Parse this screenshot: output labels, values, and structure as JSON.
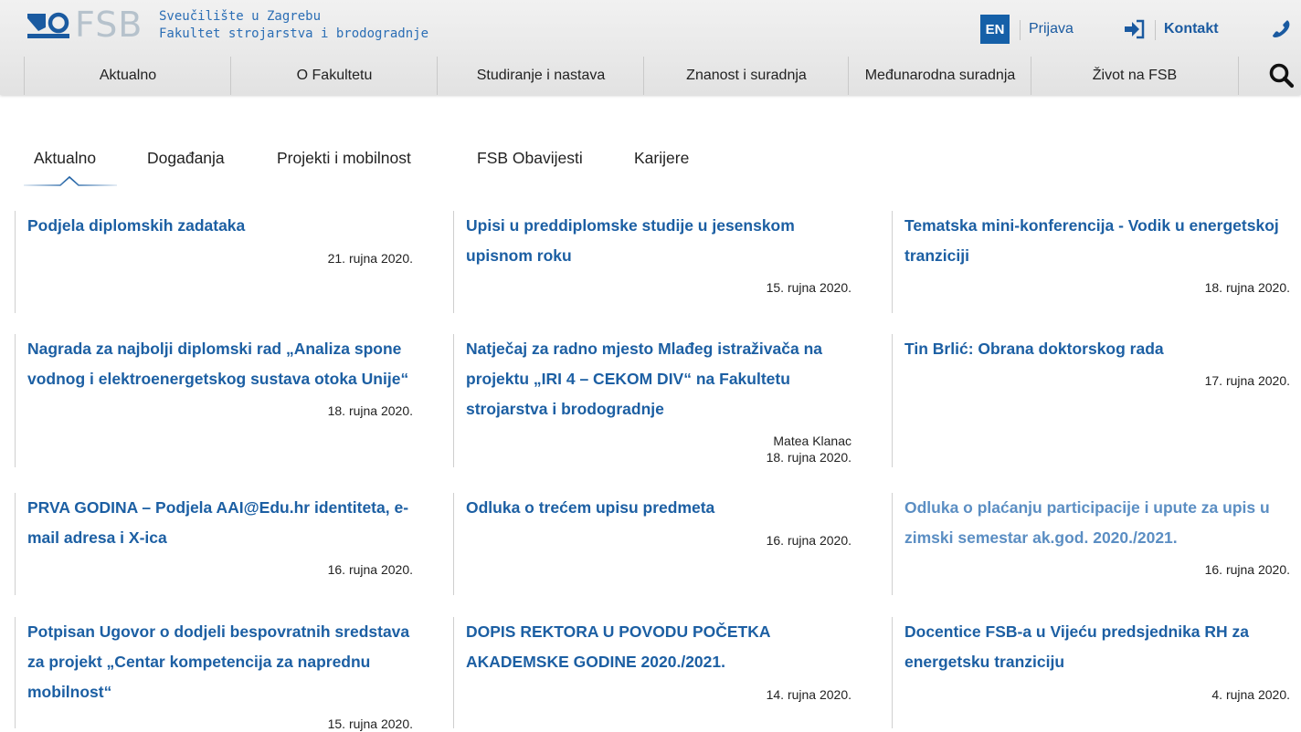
{
  "header": {
    "logo": {
      "wordmark": "FSB",
      "line1": "Sveučilište u Zagrebu",
      "line2": "Fakultet strojarstva i brodogradnje"
    },
    "lang_button": "EN",
    "login_label": "Prijava",
    "contact_label": "Kontakt"
  },
  "nav": {
    "items": [
      "Aktualno",
      "O Fakultetu",
      "Studiranje i nastava",
      "Znanost i suradnja",
      "Međunarodna suradnja",
      "Život na FSB"
    ]
  },
  "tabs": [
    "Aktualno",
    "Događanja",
    "Projekti i mobilnost",
    "FSB Obavijesti",
    "Karijere"
  ],
  "active_tab": "Aktualno",
  "news": [
    {
      "title": "Podjela diplomskih zadataka",
      "date": "21. rujna 2020."
    },
    {
      "title": "Upisi u preddiplomske studije u jesenskom upisnom roku",
      "date": "15. rujna 2020."
    },
    {
      "title": "Tematska mini-konferencija - Vodik u energetskoj tranziciji",
      "date": "18. rujna 2020."
    },
    {
      "title": "Nagrada za najbolji diplomski rad „Analiza spone vodnog i elektroenergetskog sustava otoka Unije“",
      "date": "18. rujna 2020."
    },
    {
      "title": "Natječaj za radno mjesto Mlađeg istraživača na projektu „IRI 4 – CEKOM DIV“ na Fakultetu strojarstva i brodogradnje",
      "author": "Matea Klanac",
      "date": "18. rujna 2020."
    },
    {
      "title": "Tin Brlić: Obrana doktorskog rada",
      "date": "17. rujna 2020."
    },
    {
      "title": "PRVA GODINA – Podjela AAI@Edu.hr identiteta, e-mail adresa i X-ica",
      "date": "16. rujna 2020."
    },
    {
      "title": "Odluka o trećem upisu predmeta",
      "date": "16. rujna 2020."
    },
    {
      "title": "Odluka o plaćanju participacije i upute za upis u zimski semestar ak.god. 2020./2021.",
      "date": "16. rujna 2020."
    },
    {
      "title": "Potpisan Ugovor o dodjeli bespovratnih sredstava za projekt „Centar kompetencija za naprednu mobilnost“",
      "date": "15. rujna 2020."
    },
    {
      "title": "DOPIS REKTORA U POVODU POČETKA AKADEMSKE GODINE 2020./2021.",
      "date": "14. rujna 2020."
    },
    {
      "title": "Docentice FSB-a u Vijeću predsjednika RH za energetsku tranziciju",
      "date": "4. rujna 2020."
    }
  ],
  "colors": {
    "accent": "#1560a8",
    "link": "#1c5fa3",
    "link_hover": "#5b8ec3"
  }
}
